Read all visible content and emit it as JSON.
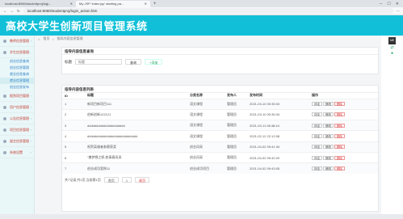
{
  "browser": {
    "tabs": [
      {
        "label": "localhost:8080/studentproj/logi...",
        "active": false
      },
      {
        "label": "My JSP 'index.jsp' starting pa...",
        "active": true
      }
    ],
    "url": "localhost:8080/studentproj/login_action.htm"
  },
  "header": {
    "title": "高校大学生创新项目管理系统"
  },
  "sidebar": {
    "groups": [
      {
        "label": "教师信息管理",
        "items": []
      },
      {
        "label": "学生信息管理",
        "items": [
          "创业信息查询",
          "创业信息管理",
          "就业信息查询",
          "就业信息管理",
          "创业信息发布"
        ]
      },
      {
        "label": "报到项目管理",
        "items": []
      },
      {
        "label": "用户信息管理",
        "items": []
      },
      {
        "label": "公告信息管理",
        "items": []
      },
      {
        "label": "项目信息管理",
        "items": []
      },
      {
        "label": "留言信息管理",
        "items": []
      },
      {
        "label": "系统设置",
        "items": []
      }
    ]
  },
  "breadcrumb": {
    "home": "首页",
    "current": "指导内容信息管理"
  },
  "search": {
    "title": "指导内容信息查询",
    "field_label": "标题",
    "placeholder": "标题",
    "search_btn": "查询",
    "add_btn": "+添加"
  },
  "list": {
    "title": "指导内容信息列表",
    "columns": [
      "ID",
      "标题",
      "分类名称",
      "发布人",
      "发布时间",
      "操作"
    ],
    "rows": [
      {
        "id": "1",
        "title": "新项目新项目111",
        "category": "语文课程",
        "publisher": "管理员",
        "time": "2021-03-10 00:35:03"
      },
      {
        "id": "2",
        "title": "创新创新122121",
        "category": "语文课程",
        "publisher": "管理员",
        "time": "2021-03-10 00:35:34"
      },
      {
        "id": "3",
        "title": "ddddddddddddddddddddd",
        "category": "语文课程",
        "publisher": "管理员",
        "time": "2021-03-11 08:48:44"
      },
      {
        "id": "4",
        "title": "dddddddddddddddddddddddddddd",
        "category": "语文课程",
        "publisher": "管理员",
        "time": "2021-02-12 22:12:08"
      },
      {
        "id": "5",
        "title": "祝贺英雄者参赛获奖",
        "category": "创业风采",
        "publisher": "管理员",
        "time": "2021-04-02 09:41:34"
      },
      {
        "id": "6",
        "title": "“携梦想之帆 航青春风采",
        "category": "创业风采",
        "publisher": "管理员",
        "time": "2021-04-02 09:42:20"
      },
      {
        "id": "7",
        "title": "创业成功案例11",
        "category": "创业成功项目",
        "publisher": "管理员",
        "time": "2021-04-02 09:43:05"
      }
    ],
    "ops": [
      "评论",
      "修改",
      "删除"
    ]
  },
  "pager": {
    "summary": "共7记录,共1页,当前第1页",
    "first": "首页",
    "page": "1",
    "last": "尾页"
  },
  "colors": {
    "header": "#11c0d8",
    "link": "#2a7ec4",
    "danger": "#d33"
  }
}
